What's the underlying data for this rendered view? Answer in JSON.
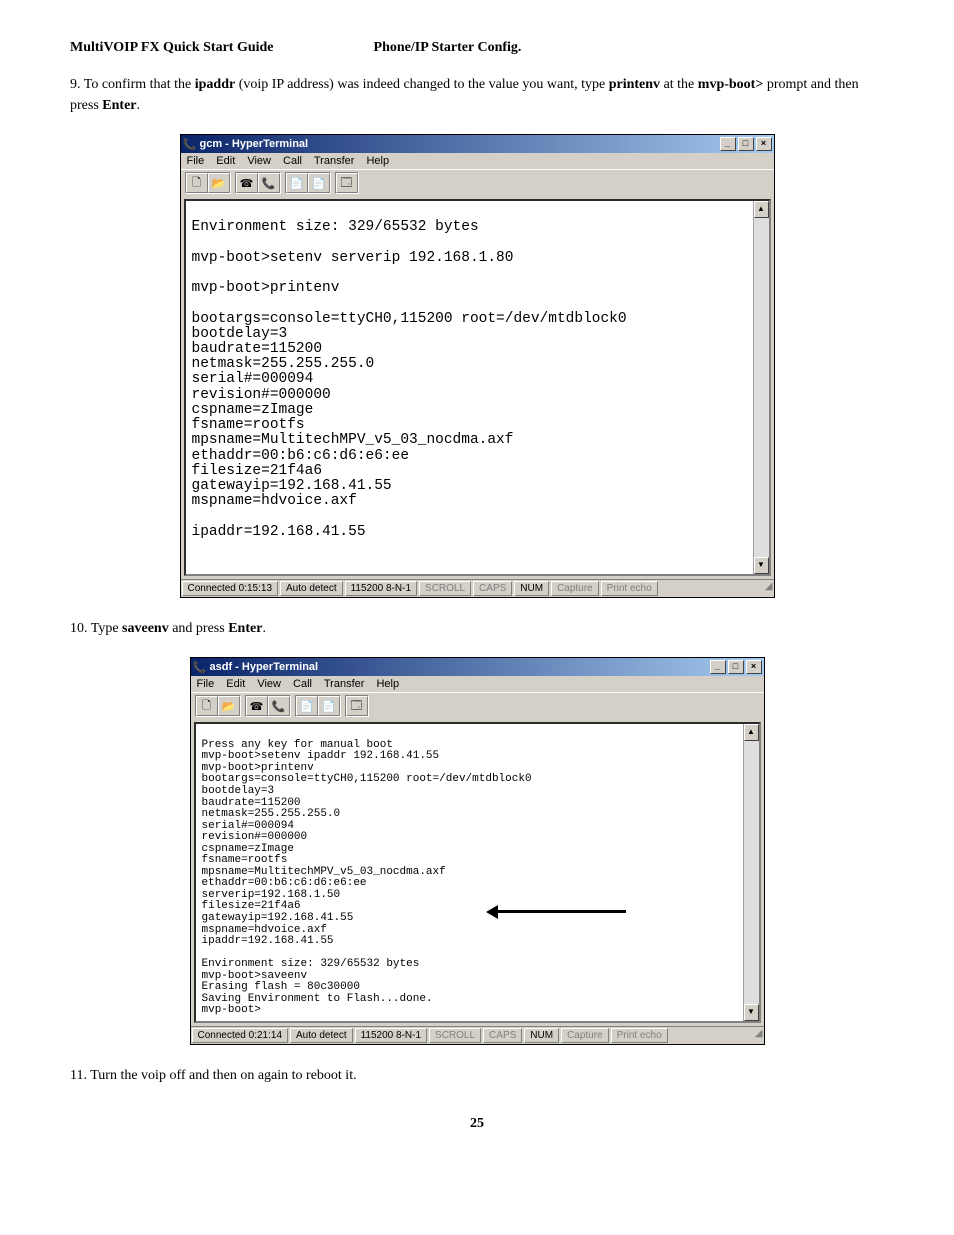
{
  "header": {
    "left": "MultiVOIP FX Quick Start Guide",
    "center": "Phone/IP Starter Config."
  },
  "step9": {
    "num": "9. ",
    "t1": "To confirm that the ",
    "b1": "ipaddr",
    "t2": " (voip IP address) was indeed changed to the value you want,  type  ",
    "b2": "printenv",
    "t3": "  at the ",
    "b3": "mvp-boot>",
    "t4": " prompt and then press ",
    "b4": "Enter",
    "t5": "."
  },
  "win1": {
    "title": "gcm - HyperTerminal",
    "menu": [
      "File",
      "Edit",
      "View",
      "Call",
      "Transfer",
      "Help"
    ],
    "term": "\nEnvironment size: 329/65532 bytes\n\nmvp-boot>setenv serverip 192.168.1.80\n\nmvp-boot>printenv\n\nbootargs=console=ttyCH0,115200 root=/dev/mtdblock0\nbootdelay=3\nbaudrate=115200\nnetmask=255.255.255.0\nserial#=000094\nrevision#=000000\ncspname=zImage\nfsname=rootfs\nmpsname=MultitechMPV_v5_03_nocdma.axf\nethaddr=00:b6:c6:d6:e6:ee\nfilesize=21f4a6\ngatewayip=192.168.41.55\nmspname=hdvoice.axf\n\nipaddr=192.168.41.55\n\n\n",
    "status": {
      "conn": "Connected 0:15:13",
      "detect": "Auto detect",
      "params": "115200 8-N-1",
      "scroll": "SCROLL",
      "caps": "CAPS",
      "num": "NUM",
      "capture": "Capture",
      "echo": "Print echo"
    }
  },
  "step10": {
    "num": "10. ",
    "t1": "Type ",
    "b1": "saveenv",
    "t2": " and press ",
    "b2": "Enter",
    "t3": "."
  },
  "win2": {
    "title": "asdf - HyperTerminal",
    "menu": [
      "File",
      "Edit",
      "View",
      "Call",
      "Transfer",
      "Help"
    ],
    "term": "\nPress any key for manual boot\nmvp-boot>setenv ipaddr 192.168.41.55\nmvp-boot>printenv\nbootargs=console=ttyCH0,115200 root=/dev/mtdblock0\nbootdelay=3\nbaudrate=115200\nnetmask=255.255.255.0\nserial#=000094\nrevision#=000000\ncspname=zImage\nfsname=rootfs\nmpsname=MultitechMPV_v5_03_nocdma.axf\nethaddr=00:b6:c6:d6:e6:ee\nserverip=192.168.1.50\nfilesize=21f4a6\ngatewayip=192.168.41.55\nmspname=hdvoice.axf\nipaddr=192.168.41.55\n\nEnvironment size: 329/65532 bytes\nmvp-boot>saveenv\nErasing flash = 80c30000\nSaving Environment to Flash...done.\nmvp-boot>",
    "status": {
      "conn": "Connected 0:21:14",
      "detect": "Auto detect",
      "params": "115200 8-N-1",
      "scroll": "SCROLL",
      "caps": "CAPS",
      "num": "NUM",
      "capture": "Capture",
      "echo": "Print echo"
    }
  },
  "step11": {
    "num": "11. ",
    "t1": "Turn the voip off and then on again to reboot it."
  },
  "icons": {
    "new": "🗋",
    "open": "📂",
    "call": "☎",
    "hang": "📞",
    "send": "📄",
    "recv": "📄",
    "prop": "🗔",
    "min": "_",
    "max": "□",
    "close": "×",
    "up": "▲",
    "down": "▼",
    "grip": "◢",
    "app": "📞"
  },
  "pagenum": "25"
}
